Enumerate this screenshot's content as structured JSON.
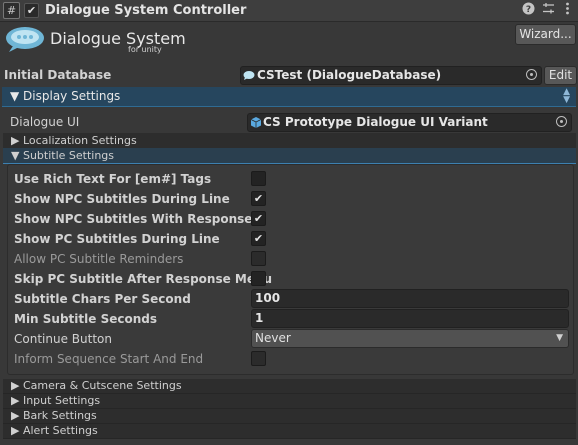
{
  "header": {
    "title": "Dialogue System Controller",
    "hash_icon": "#",
    "enabled_check": "✔",
    "icons": [
      "help-icon",
      "preset-icon",
      "more-icon"
    ]
  },
  "logo": {
    "title": "Dialogue System",
    "subtitle": "for unity"
  },
  "wizard_label": "Wizard...",
  "initial_database": {
    "label": "Initial Database",
    "value": "CSTest (DialogueDatabase)",
    "edit_label": "Edit"
  },
  "display_settings": {
    "label": "Display Settings"
  },
  "dialogue_ui": {
    "label": "Dialogue UI",
    "value": "CS Prototype Dialogue UI Variant"
  },
  "localization_settings": {
    "label": "Localization Settings"
  },
  "subtitle_settings": {
    "label": "Subtitle Settings",
    "fields": [
      {
        "label": "Use Rich Text For [em#] Tags",
        "check": ""
      },
      {
        "label": "Show NPC Subtitles During Line",
        "check": "✔"
      },
      {
        "label": "Show NPC Subtitles With Responses",
        "check": "✔"
      },
      {
        "label": "Show PC Subtitles During Line",
        "check": "✔"
      },
      {
        "label": "Allow PC Subtitle Reminders",
        "check": ""
      },
      {
        "label": "Skip PC Subtitle After Response Menu",
        "check": ""
      },
      {
        "label": "Subtitle Chars Per Second",
        "value": "100"
      },
      {
        "label": "Min Subtitle Seconds",
        "value": "1"
      },
      {
        "label": "Continue Button",
        "value": "Never"
      },
      {
        "label": "Inform Sequence Start And End",
        "check": ""
      }
    ]
  },
  "collapsed_sections": [
    {
      "label": "Camera & Cutscene Settings"
    },
    {
      "label": "Input Settings"
    },
    {
      "label": "Bark Settings"
    },
    {
      "label": "Alert Settings"
    }
  ],
  "colors": {
    "accent": "#2f6b93",
    "background": "#383838",
    "field": "#2a2a2a"
  }
}
